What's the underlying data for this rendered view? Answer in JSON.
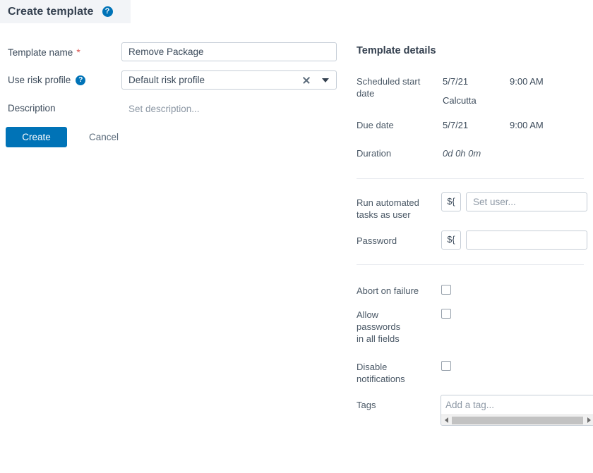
{
  "header": {
    "title": "Create template",
    "help_icon": "question-mark-circle-icon",
    "help_glyph": "?"
  },
  "form": {
    "template_name": {
      "label": "Template name",
      "required_marker": "*",
      "value": "Remove Package"
    },
    "risk_profile": {
      "label": "Use risk profile",
      "help_glyph": "?",
      "value": "Default risk profile",
      "clear_icon": "close-x-icon",
      "dropdown_icon": "chevron-down-icon"
    },
    "description": {
      "label": "Description",
      "placeholder": "Set description..."
    },
    "create_button": "Create",
    "cancel_button": "Cancel"
  },
  "details": {
    "title": "Template details",
    "scheduled_start": {
      "label": "Scheduled start date",
      "date": "5/7/21",
      "time": "9:00 AM",
      "timezone": "Calcutta"
    },
    "due_date": {
      "label": "Due date",
      "date": "5/7/21",
      "time": "9:00 AM"
    },
    "duration": {
      "label": "Duration",
      "value": "0d 0h 0m"
    },
    "run_as_user": {
      "label": "Run automated tasks as user",
      "variable_button": "${",
      "placeholder": "Set user...",
      "value": ""
    },
    "password": {
      "label": "Password",
      "variable_button": "${",
      "placeholder": "",
      "value": ""
    },
    "abort_on_failure": {
      "label": "Abort on failure",
      "checked": false
    },
    "allow_passwords": {
      "label": "Allow passwords in all fields",
      "checked": false
    },
    "disable_notifications": {
      "label": "Disable notifications",
      "checked": false
    },
    "tags": {
      "label": "Tags",
      "placeholder": "Add a tag...",
      "value": "",
      "scroll_left_icon": "triangle-left-icon",
      "scroll_right_icon": "triangle-right-icon"
    }
  },
  "colors": {
    "accent": "#0073b7",
    "header_bg": "#f2f4f7",
    "required": "#d9534f",
    "text": "#3b4a5a"
  }
}
